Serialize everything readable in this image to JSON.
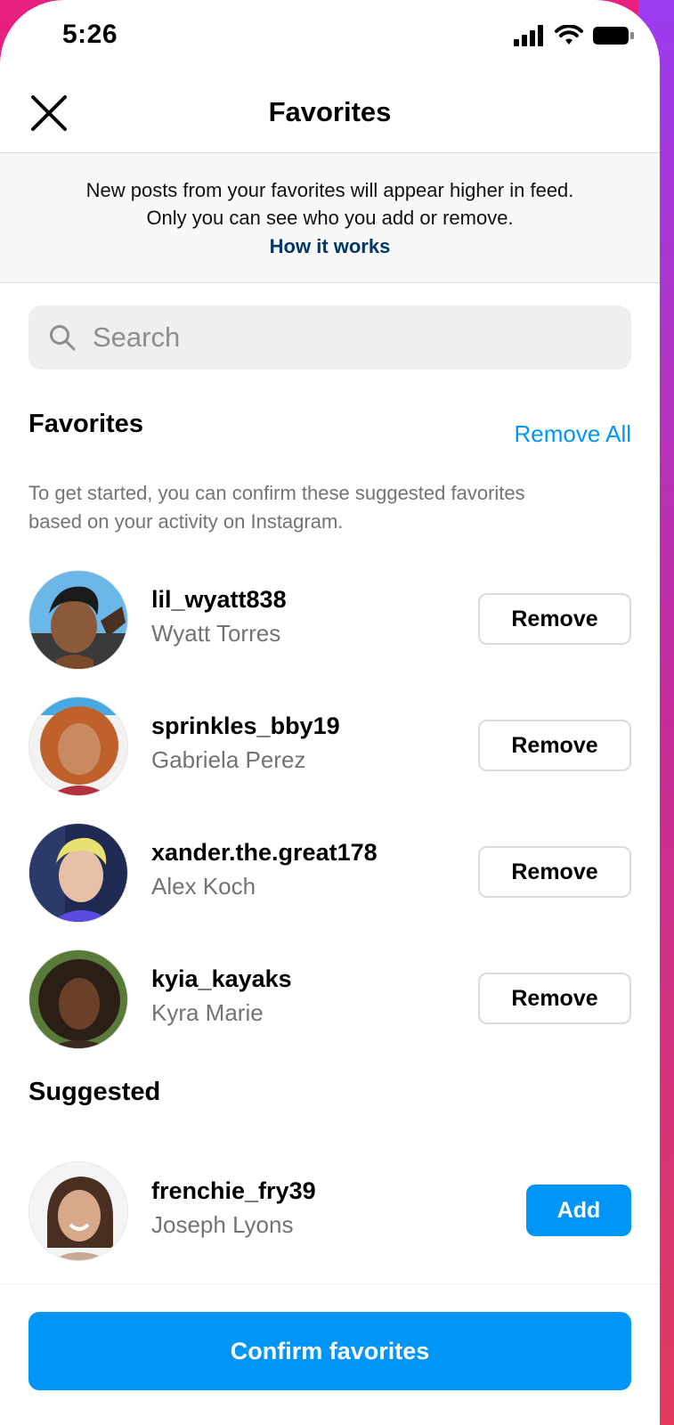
{
  "status_bar": {
    "time": "5:26"
  },
  "header": {
    "title": "Favorites",
    "close_icon": "close-icon"
  },
  "banner": {
    "line1": "New posts from your favorites will appear higher in feed.",
    "line2": "Only you can see who you add or remove.",
    "link": "How it works"
  },
  "search": {
    "placeholder": "Search"
  },
  "favorites": {
    "title": "Favorites",
    "remove_all": "Remove All",
    "help_line1": "To get started, you can confirm these suggested favorites",
    "help_line2": "based on your activity on Instagram.",
    "items": [
      {
        "username": "lil_wyatt838",
        "name": "Wyatt Torres",
        "action": "Remove"
      },
      {
        "username": "sprinkles_bby19",
        "name": "Gabriela Perez",
        "action": "Remove"
      },
      {
        "username": "xander.the.great178",
        "name": "Alex Koch",
        "action": "Remove"
      },
      {
        "username": "kyia_kayaks",
        "name": "Kyra Marie",
        "action": "Remove"
      }
    ]
  },
  "suggested": {
    "title": "Suggested",
    "items": [
      {
        "username": "frenchie_fry39",
        "name": "Joseph Lyons",
        "action": "Add"
      }
    ]
  },
  "footer": {
    "confirm_label": "Confirm favorites"
  },
  "colors": {
    "accent": "#0095f6",
    "link_dark": "#00376b",
    "secondary_text": "#737373",
    "border": "#dbdbdb"
  }
}
